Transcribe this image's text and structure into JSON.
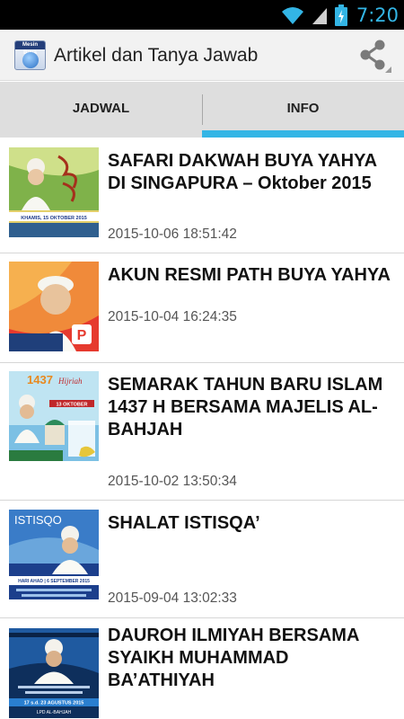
{
  "status_bar": {
    "time": "7:20"
  },
  "app": {
    "title": "Artikel dan Tanya Jawab",
    "icon_label": "Mesin Buya"
  },
  "tabs": [
    {
      "label": "JADWAL",
      "selected": false
    },
    {
      "label": "INFO",
      "selected": true
    }
  ],
  "articles": [
    {
      "title": "SAFARI DAKWAH BUYA YAHYA DI SINGAPURA – Oktober 2015",
      "date": "2015-10-06 18:51:42"
    },
    {
      "title": "AKUN RESMI PATH BUYA YAHYA",
      "date": "2015-10-04 16:24:35"
    },
    {
      "title": "SEMARAK TAHUN BARU ISLAM 1437 H BERSAMA MAJELIS AL-BAHJAH",
      "date": "2015-10-02 13:50:34"
    },
    {
      "title": "SHALAT ISTISQA’",
      "date": "2015-09-04 13:02:33"
    },
    {
      "title": "DAUROH ILMIYAH BERSAMA SYAIKH MUHAMMAD BA’ATHIYAH",
      "date": ""
    }
  ],
  "thumb_text": {
    "t1_banner": "KHAMIS, 15 OKTOBER 2015",
    "t3_year": "1437",
    "t3_hijriah": "Hijriah",
    "t3_date": "13 OKTOBER",
    "t4_title": "ISTISQO",
    "t4_date": "HARI AHAD | 6 SEPTEMBER 2015",
    "t5_date": "17 s.d. 23 AGUSTUS 2015",
    "t5_org": "LPD AL-BAHJAH"
  },
  "colors": {
    "accent": "#33b5e5",
    "tab_bg": "#dedede",
    "actionbar_bg": "#f2f2f2"
  },
  "icons": {
    "share": "share-icon",
    "wifi": "wifi-icon",
    "signal": "signal-icon",
    "battery": "battery-charging-icon"
  }
}
